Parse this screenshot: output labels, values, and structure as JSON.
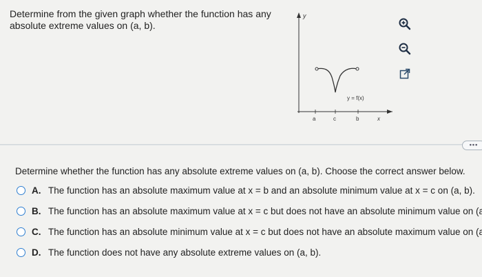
{
  "prompt": {
    "line1": "Determine from the given graph whether the function has any",
    "line2": "absolute extreme values on (a, b)."
  },
  "graph": {
    "y_axis_label": "y",
    "x_axis_label": "x",
    "tick_a": "a",
    "tick_c": "c",
    "tick_b": "b",
    "curve_label": "y = f(x)"
  },
  "tools": [
    {
      "icon": "zoom-in-icon"
    },
    {
      "icon": "zoom-out-icon"
    },
    {
      "icon": "external-link-icon"
    }
  ],
  "more_label": "•••",
  "question": "Determine whether the function has any absolute extreme values on (a, b). Choose the correct answer below.",
  "options": [
    {
      "letter": "A.",
      "text": "The function has an absolute maximum value at x = b and an absolute minimum value at x = c on (a, b)."
    },
    {
      "letter": "B.",
      "text": "The function has an absolute maximum value at x = c but does not have an absolute minimum value on (a, b)."
    },
    {
      "letter": "C.",
      "text": "The function has an absolute minimum value at x = c but does not have an absolute maximum value on (a, b)."
    },
    {
      "letter": "D.",
      "text": "The function does not have any absolute extreme values on (a, b)."
    }
  ],
  "colors": {
    "accent": "#2f7fd1",
    "divider": "#cfd4d8"
  }
}
